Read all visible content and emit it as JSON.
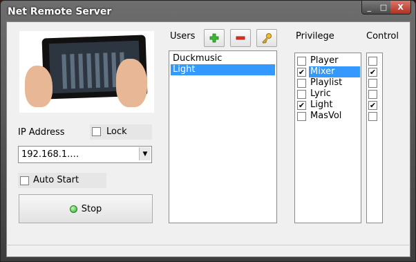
{
  "window": {
    "title": "Net Remote Server",
    "minimize": "_",
    "maximize": "□",
    "close": "X"
  },
  "ip": {
    "label": "IP Address",
    "value": "192.168.1.…"
  },
  "lock": {
    "label": "Lock",
    "checked": false
  },
  "auto_start": {
    "label": "Auto Start",
    "checked": false
  },
  "stop_button": {
    "label": "Stop",
    "status_color": "#2da82a"
  },
  "users": {
    "label": "Users",
    "add_icon": "plus-icon",
    "remove_icon": "minus-icon",
    "key_icon": "key-icon",
    "items": [
      {
        "name": "Duckmusic",
        "selected": false
      },
      {
        "name": "Light",
        "selected": true
      }
    ]
  },
  "privilege": {
    "label": "Privilege",
    "items": [
      {
        "name": "Player",
        "checked": false,
        "selected": false
      },
      {
        "name": "Mixer",
        "checked": true,
        "selected": true
      },
      {
        "name": "Playlist",
        "checked": false,
        "selected": false
      },
      {
        "name": "Lyric",
        "checked": false,
        "selected": false
      },
      {
        "name": "Light",
        "checked": true,
        "selected": false
      },
      {
        "name": "MasVol",
        "checked": false,
        "selected": false
      }
    ]
  },
  "control": {
    "label": "Control",
    "checks": [
      false,
      true,
      false,
      false,
      true,
      false
    ]
  },
  "colors": {
    "selection": "#3399ff",
    "client_bg": "#f0f0f0"
  }
}
